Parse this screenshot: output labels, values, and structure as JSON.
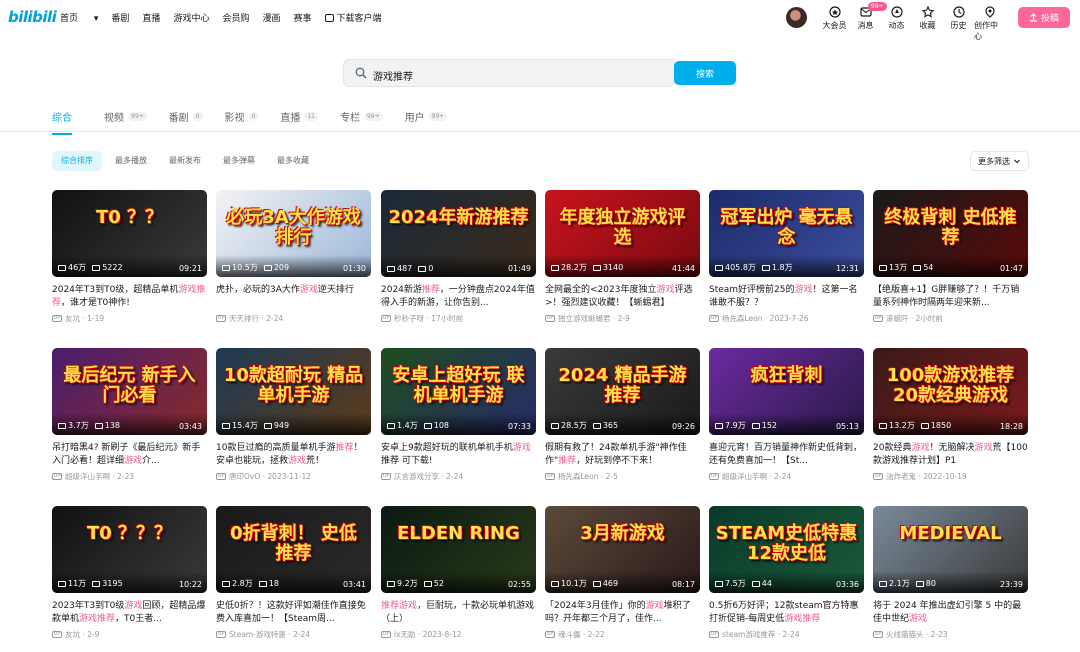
{
  "header": {
    "logo": "bilibili",
    "nav": [
      "首页",
      "番剧",
      "直播",
      "游戏中心",
      "会员购",
      "漫画",
      "赛事",
      "下载客户端"
    ],
    "right": [
      {
        "label": "大会员",
        "icon": "vip-icon"
      },
      {
        "label": "消息",
        "icon": "message-icon",
        "badge": "99+"
      },
      {
        "label": "动态",
        "icon": "dynamic-icon"
      },
      {
        "label": "收藏",
        "icon": "star-icon"
      },
      {
        "label": "历史",
        "icon": "history-icon"
      },
      {
        "label": "创作中心",
        "icon": "creator-icon"
      }
    ],
    "upload": "投稿"
  },
  "search": {
    "query": "游戏推荐",
    "button": "搜索"
  },
  "tabs": [
    {
      "label": "综合",
      "count": ""
    },
    {
      "label": "视频",
      "count": "99+"
    },
    {
      "label": "番剧",
      "count": "0"
    },
    {
      "label": "影视",
      "count": "0"
    },
    {
      "label": "直播",
      "count": "11"
    },
    {
      "label": "专栏",
      "count": "99+"
    },
    {
      "label": "用户",
      "count": "99+"
    }
  ],
  "sort": [
    "综合排序",
    "最多播放",
    "最新发布",
    "最多弹幕",
    "最多收藏"
  ],
  "filter": "更多筛选",
  "videos": [
    {
      "pre": "2024年T3到T0级，超精品单机",
      "hl": "游戏推荐",
      "post": "，谁才是T0神作!",
      "author": "友坑",
      "date": "1-19",
      "views": "46万",
      "danmaku": "5222",
      "duration": "09:21",
      "overlay": "T0 ？？",
      "colors": [
        "#111",
        "#3a3a3a"
      ]
    },
    {
      "pre": "虎扑，必玩的3A大作",
      "hl": "游戏",
      "post": "逆天排行",
      "author": "天天排行",
      "date": "2-24",
      "views": "10.5万",
      "danmaku": "209",
      "duration": "01:30",
      "overlay": "必玩3A大作游戏排行",
      "colors": [
        "#f4f4f4",
        "#9bb6d8"
      ]
    },
    {
      "pre": "2024新游",
      "hl": "推荐",
      "post": "，一分钟盘点2024年值得入手的新游，让你告别...",
      "author": "秒秒子呀",
      "date": "17小时前",
      "views": "487",
      "danmaku": "0",
      "duration": "01:49",
      "overlay": "2024年新游推荐",
      "colors": [
        "#1a2a3a",
        "#3b2a1a"
      ]
    },
    {
      "pre": "全网最全的<2023年度独立",
      "hl": "游戏",
      "post": "评选>！强烈建议收藏！【蜥蜴君】",
      "author": "独立游戏蜥蜴君",
      "date": "2-9",
      "views": "28.2万",
      "danmaku": "3140",
      "duration": "41:44",
      "overlay": "年度独立游戏评选",
      "colors": [
        "#c8141e",
        "#7a0a10"
      ]
    },
    {
      "pre": "Steam好评榜前25的",
      "hl": "游戏",
      "post": "！这第一名谁敢不服？？",
      "author": "杨先森Leon",
      "date": "2023-7-26",
      "views": "405.8万",
      "danmaku": "1.8万",
      "duration": "12:31",
      "overlay": "冠军出炉 毫无悬念",
      "colors": [
        "#1b2b6b",
        "#3d4e9e"
      ]
    },
    {
      "pre": "【绝版喜+1】G胖赚够了？！千万销量系列神作时隔两年迎来新...",
      "hl": "",
      "post": "",
      "author": "滚蜡阡",
      "date": "2小时前",
      "views": "13万",
      "danmaku": "54",
      "duration": "01:47",
      "overlay": "终极背刺 史低推荐",
      "colors": [
        "#1a1a1a",
        "#5a0a0a"
      ]
    },
    {
      "pre": "吊打暗黑4? 新刷子《最后纪元》新手入门必看！超详细",
      "hl": "游戏",
      "post": "介...",
      "author": "超级洋山芋啊",
      "date": "2-23",
      "views": "3.7万",
      "danmaku": "138",
      "duration": "03:43",
      "overlay": "最后纪元 新手入门必看",
      "colors": [
        "#4a1d6e",
        "#8a2a2a"
      ]
    },
    {
      "pre": "10款巨过瘾的高质量单机手游",
      "hl": "推荐",
      "post": "！安卓也能玩，拯救",
      "hl2": "游戏",
      "post2": "荒！",
      "author": "唐印OvO",
      "date": "2023-11-12",
      "views": "15.4万",
      "danmaku": "949",
      "duration": "",
      "overlay": "10款超耐玩 精品单机手游",
      "colors": [
        "#1e3a55",
        "#5b3a1a"
      ]
    },
    {
      "pre": "安卓上9款超好玩的联机单机手机",
      "hl": "游戏",
      "post": "推荐 可下载!",
      "author": "仄言游戏分享",
      "date": "2-24",
      "views": "1.4万",
      "danmaku": "108",
      "duration": "07:33",
      "overlay": "安卓上超好玩 联机单机手游",
      "colors": [
        "#1d4d1d",
        "#2a2a6a"
      ]
    },
    {
      "pre": "假期有救了！24款单机手游\"神作佳作\"",
      "hl": "推荐",
      "post": "，好玩到停不下来！",
      "author": "杨先森Leon",
      "date": "2-5",
      "views": "28.5万",
      "danmaku": "365",
      "duration": "09:26",
      "overlay": "2024 精品手游推荐",
      "colors": [
        "#3a3a3a",
        "#1a1a1a"
      ]
    },
    {
      "pre": "喜迎元宵！百万销量神作新史低背刺，还有免费喜加一！【St...",
      "hl": "",
      "post": "",
      "author": "超级洋山芋啊",
      "date": "2-24",
      "views": "7.9万",
      "danmaku": "152",
      "duration": "05:13",
      "overlay": "疯狂背刺",
      "colors": [
        "#6b2a9e",
        "#2a1a4a"
      ]
    },
    {
      "pre": "20款经典",
      "hl": "游戏",
      "post": "！无脑解决",
      "hl2": "游戏",
      "post2": "荒【100款游戏推荐计划】P1",
      "author": "油炸老鬼",
      "date": "2022-10-19",
      "views": "13.2万",
      "danmaku": "1850",
      "duration": "18:28",
      "overlay": "100款游戏推荐 20款经典游戏",
      "colors": [
        "#3a1a1a",
        "#7a1a1a"
      ]
    },
    {
      "pre": "2023年T3到T0级",
      "hl": "游戏",
      "post": "回顾，超精品爆款单机",
      "hl2": "游戏推荐",
      "post2": "，T0王者...",
      "author": "友坑",
      "date": "2-9",
      "views": "11万",
      "danmaku": "3195",
      "duration": "10:22",
      "overlay": "T0 ？？？",
      "colors": [
        "#111",
        "#3a3a3a"
      ]
    },
    {
      "pre": "史低0折？！这款好评如潮佳作直接免费入库喜加一！【Steam周...",
      "hl": "",
      "post": "",
      "author": "Steam-游戏特惠",
      "date": "2-24",
      "views": "2.8万",
      "danmaku": "18",
      "duration": "03:41",
      "overlay": "0折背刺！ 史低推荐",
      "colors": [
        "#1a1a1a",
        "#2a2a2a"
      ]
    },
    {
      "pre": "",
      "hl": "推荐游戏",
      "post": "，巨耐玩，十款必玩单机游戏（上）",
      "author": "lx无助",
      "date": "2023-8-12",
      "views": "9.2万",
      "danmaku": "52",
      "duration": "02:55",
      "overlay": "ELDEN RING",
      "colors": [
        "#0a1a12",
        "#2a3a1a"
      ]
    },
    {
      "pre": "「2024年3月佳作」你的",
      "hl": "游戏",
      "post": "堆积了吗？开年都三个月了，佳作...",
      "author": "魂斗儡",
      "date": "2-22",
      "views": "10.1万",
      "danmaku": "469",
      "duration": "08:17",
      "overlay": "3月新游戏",
      "colors": [
        "#5a4a3a",
        "#2a1a1a"
      ]
    },
    {
      "pre": "0.5折6万好评；12款steam官方特惠打折促销-每周史低",
      "hl": "游戏推荐",
      "post": "",
      "author": "steam游戏推荐",
      "date": "2-24",
      "views": "7.5万",
      "danmaku": "44",
      "duration": "03:36",
      "overlay": "STEAM史低特惠 12款史低",
      "colors": [
        "#0a3a2a",
        "#1a5a3a"
      ]
    },
    {
      "pre": "将于 2024 年推出虚幻引擎 5 中的最佳中世纪",
      "hl": "游戏",
      "post": "",
      "author": "火线猫猫头",
      "date": "2-23",
      "views": "2.1万",
      "danmaku": "80",
      "duration": "23:39",
      "overlay": "MEDIEVAL",
      "colors": [
        "#7a8a9a",
        "#3a3a3a"
      ]
    }
  ]
}
